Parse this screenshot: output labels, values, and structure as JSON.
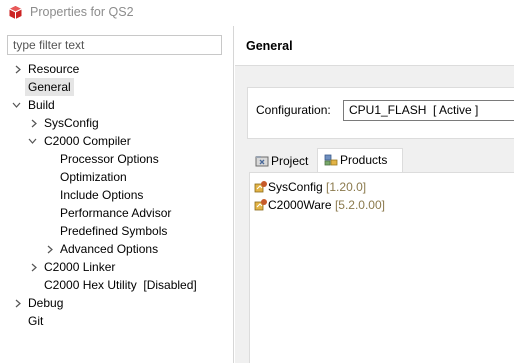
{
  "window": {
    "title": "Properties for QS2"
  },
  "filter": {
    "placeholder": "type filter text",
    "value": ""
  },
  "tree": {
    "items": [
      {
        "label": "Resource",
        "expand": "collapsed"
      },
      {
        "label": "General",
        "expand": "none",
        "selected": true
      },
      {
        "label": "Build",
        "expand": "expanded"
      },
      {
        "label": "SysConfig",
        "expand": "collapsed"
      },
      {
        "label": "C2000 Compiler",
        "expand": "expanded"
      },
      {
        "label": "Processor Options",
        "expand": "none"
      },
      {
        "label": "Optimization",
        "expand": "none"
      },
      {
        "label": "Include Options",
        "expand": "none"
      },
      {
        "label": "Performance Advisor",
        "expand": "none"
      },
      {
        "label": "Predefined Symbols",
        "expand": "none"
      },
      {
        "label": "Advanced Options",
        "expand": "collapsed"
      },
      {
        "label": "C2000 Linker",
        "expand": "collapsed"
      },
      {
        "label": "C2000 Hex Utility  [Disabled]",
        "expand": "none"
      },
      {
        "label": "Debug",
        "expand": "collapsed"
      },
      {
        "label": "Git",
        "expand": "none"
      }
    ]
  },
  "main": {
    "title": "General",
    "configuration": {
      "label": "Configuration:",
      "value": "CPU1_FLASH  [ Active ]"
    },
    "tabs": [
      {
        "label": "Project",
        "icon": "project-icon",
        "active": false
      },
      {
        "label": "Products",
        "icon": "products-icon",
        "active": true
      }
    ],
    "products": [
      {
        "name": "SysConfig",
        "version": "[1.20.0]"
      },
      {
        "name": "C2000Ware",
        "version": "[5.2.0.00]"
      }
    ]
  },
  "colors": {
    "version_text": "#8b7a4d",
    "selection": "#e5e5e5",
    "title_icon": "#cc2222"
  }
}
